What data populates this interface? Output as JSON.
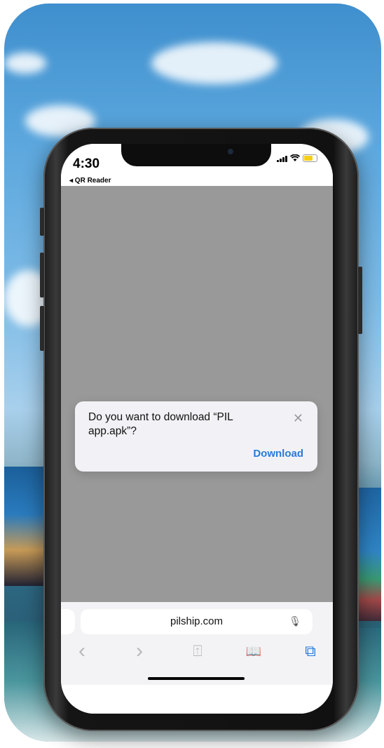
{
  "status_bar": {
    "time": "4:30",
    "back_label": "◂ QR Reader"
  },
  "dialog": {
    "message": "Do you want to download “PIL app.apk”?",
    "action_label": "Download",
    "close_glyph": "✕"
  },
  "address_bar": {
    "url": "pilship.com",
    "mic_glyph": "🎙"
  },
  "toolbar": {
    "back_glyph": "‹",
    "forward_glyph": "›",
    "share_glyph": "⍐",
    "bookmarks_glyph": "📖",
    "tabs_glyph": "⧉"
  },
  "colors": {
    "accent": "#2a7ad8",
    "dimmed_overlay": "#999999",
    "battery": "#f5cf1b"
  }
}
